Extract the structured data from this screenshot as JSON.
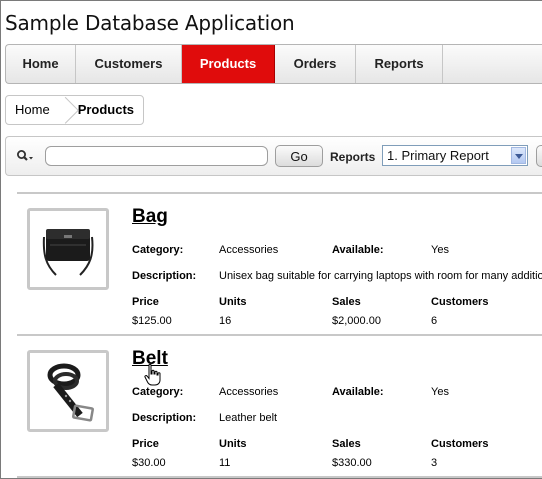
{
  "app": {
    "title": "Sample Database Application"
  },
  "tabs": [
    {
      "label": "Home"
    },
    {
      "label": "Customers"
    },
    {
      "label": "Products"
    },
    {
      "label": "Orders"
    },
    {
      "label": "Reports"
    }
  ],
  "active_tab": "Products",
  "breadcrumb": [
    {
      "label": "Home"
    },
    {
      "label": "Products"
    }
  ],
  "search": {
    "value": "",
    "placeholder": "",
    "go_label": "Go",
    "reports_label": "Reports",
    "report_selected": "1. Primary Report"
  },
  "field_labels": {
    "category": "Category:",
    "available": "Available:",
    "description": "Description:",
    "price": "Price",
    "units": "Units",
    "sales": "Sales",
    "customers": "Customers"
  },
  "products": [
    {
      "name": "Bag",
      "icon": "bag-image",
      "category": "Accessories",
      "available": "Yes",
      "description": "Unisex bag suitable for carrying laptops with room for many additio",
      "price": "$125.00",
      "units": "16",
      "sales": "$2,000.00",
      "customers": "6"
    },
    {
      "name": "Belt",
      "icon": "belt-image",
      "category": "Accessories",
      "available": "Yes",
      "description": "Leather belt",
      "price": "$30.00",
      "units": "11",
      "sales": "$330.00",
      "customers": "3"
    }
  ],
  "colors": {
    "active_tab": "#e00c0c",
    "tab_bar": "#e6e6e6",
    "divider": "#c8c8c8"
  }
}
